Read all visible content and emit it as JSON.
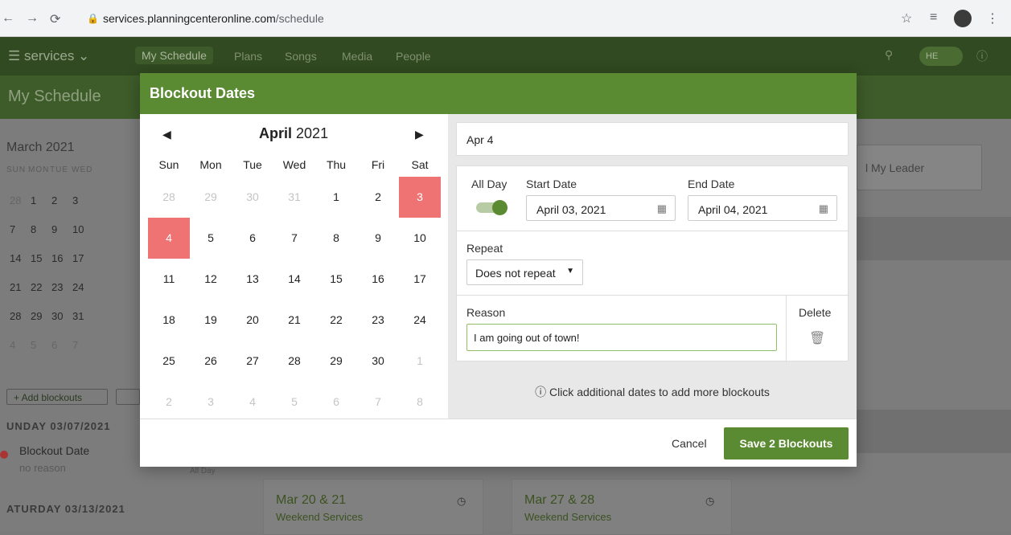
{
  "browser": {
    "url_host": "services.planningcenteronline.com",
    "url_path": "/schedule",
    "avatar_initials": "HE"
  },
  "app": {
    "brand": "services",
    "nav": [
      "My Schedule",
      "Plans",
      "Songs",
      "Media",
      "People"
    ],
    "page_title": "My Schedule"
  },
  "background": {
    "mini_month": "March 2021",
    "mini_dows": [
      "SUN",
      "MON",
      "TUE",
      "WED"
    ],
    "mini_rows": [
      [
        "28",
        "1",
        "2",
        "3"
      ],
      [
        "7",
        "8",
        "9",
        "10"
      ],
      [
        "14",
        "15",
        "16",
        "17"
      ],
      [
        "21",
        "22",
        "23",
        "24"
      ],
      [
        "28",
        "29",
        "30",
        "31"
      ],
      [
        "4",
        "5",
        "6",
        "7"
      ]
    ],
    "add_blockouts": "+ Add blockouts",
    "email_leader": "l My Leader",
    "date_heading_1": "UNDAY 03/07/2021",
    "blockout_title": "Blockout Date",
    "blockout_reason": "no reason",
    "all_day": "All Day",
    "date_heading_2": "ATURDAY 03/13/2021",
    "card1_title": "Mar 20 & 21",
    "card1_sub": "Weekend Services",
    "card2_title": "Mar 27 & 28",
    "card2_sub": "Weekend Services"
  },
  "modal": {
    "title": "Blockout Dates",
    "calendar": {
      "month": "April",
      "year": "2021",
      "prev_arrow": "◀",
      "next_arrow": "▶",
      "dows": [
        "Sun",
        "Mon",
        "Tue",
        "Wed",
        "Thu",
        "Fri",
        "Sat"
      ],
      "weeks": [
        [
          "28",
          "29",
          "30",
          "31",
          "1",
          "2",
          "3"
        ],
        [
          "4",
          "5",
          "6",
          "7",
          "8",
          "9",
          "10"
        ],
        [
          "11",
          "12",
          "13",
          "14",
          "15",
          "16",
          "17"
        ],
        [
          "18",
          "19",
          "20",
          "21",
          "22",
          "23",
          "24"
        ],
        [
          "25",
          "26",
          "27",
          "28",
          "29",
          "30",
          "1"
        ],
        [
          "2",
          "3",
          "4",
          "5",
          "6",
          "7",
          "8"
        ]
      ],
      "selected_days": [
        "3",
        "4"
      ],
      "selected_color": "#f07373"
    },
    "selected_label": "Apr 4",
    "all_day_label": "All Day",
    "all_day_on": true,
    "start_date_label": "Start Date",
    "start_date_value": "April 03, 2021",
    "end_date_label": "End Date",
    "end_date_value": "April 04, 2021",
    "repeat_label": "Repeat",
    "repeat_value": "Does not repeat",
    "reason_label": "Reason",
    "reason_value": "I am going out of town!",
    "delete_label": "Delete",
    "hint": "ⓘ  Click additional dates to add more blockouts",
    "cancel_label": "Cancel",
    "save_label": "Save 2 Blockouts",
    "accent_color": "#5a8a32"
  }
}
